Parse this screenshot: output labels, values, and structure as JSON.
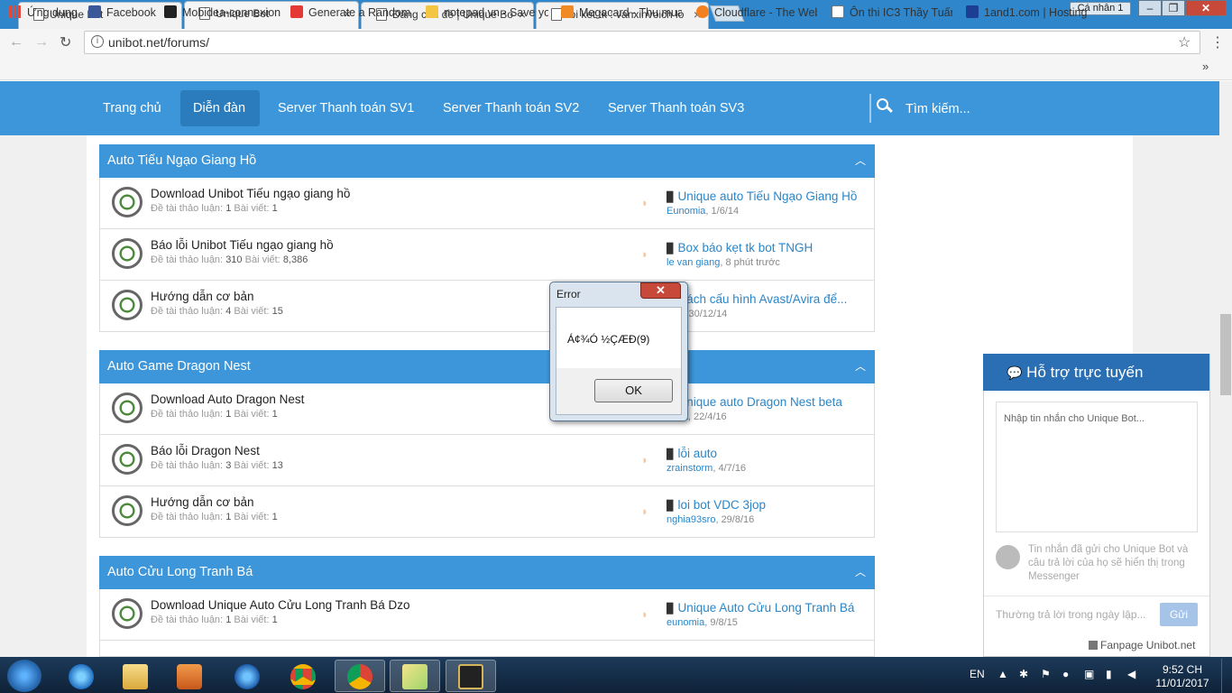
{
  "browser": {
    "tabs": [
      {
        "label": "Unique Bot"
      },
      {
        "label": "Unique Bot"
      },
      {
        "label": "Đăng chủ đề | Unique Bo"
      },
      {
        "label": "loi ket tk : vanxinvoich lo"
      }
    ],
    "profile_label": "Cá nhân 1",
    "url": "unibot.net/forums/",
    "bookmarks": [
      {
        "label": "Ứng dụng",
        "color": "#e04a3a"
      },
      {
        "label": "Facebook",
        "color": "#3b5998"
      },
      {
        "label": "Mobidea-connexion",
        "color": "#222222"
      },
      {
        "label": "Generate a Random N",
        "color": "#e53935"
      },
      {
        "label": "notepad.vn - Save you",
        "color": "#f4c542"
      },
      {
        "label": "Megacard - Thu mua",
        "color": "#f08a24"
      },
      {
        "label": "Cloudflare - The Web",
        "color": "#f38020"
      },
      {
        "label": "Ôn thi IC3 Thầy Tuấn",
        "color": "#ffffff"
      },
      {
        "label": "1and1.com | Hosting,",
        "color": "#1c3f94"
      }
    ]
  },
  "site_nav": {
    "items": [
      {
        "label": "Trang chủ",
        "active": false
      },
      {
        "label": "Diễn đàn",
        "active": true
      },
      {
        "label": "Server Thanh toán SV1",
        "active": false
      },
      {
        "label": "Server Thanh toán SV2",
        "active": false
      },
      {
        "label": "Server Thanh toán SV3",
        "active": false
      }
    ],
    "search_label": "Tìm kiếm..."
  },
  "categories": [
    {
      "title": "Auto Tiếu Ngạo Giang Hồ",
      "forums": [
        {
          "title": "Download Unibot Tiếu ngạo giang hồ",
          "threads_label": "Đề tài thảo luận:",
          "threads": "1",
          "posts_label": "Bài viết:",
          "posts": "1",
          "last_title": "Unique auto Tiếu Ngạo Giang Hồ",
          "last_user": "Eunomia",
          "last_time": "1/6/14"
        },
        {
          "title": "Báo lỗi Unibot Tiếu ngạo giang hồ",
          "threads_label": "Đề tài thảo luận:",
          "threads": "310",
          "posts_label": "Bài viết:",
          "posts": "8,386",
          "last_title": "Box báo kẹt tk bot TNGH",
          "last_user": "le van giang",
          "last_time": "8 phút trước"
        },
        {
          "title": "Hướng dẫn cơ bản",
          "threads_label": "Đề tài thảo luận:",
          "threads": "4",
          "posts_label": "Bài viết:",
          "posts": "15",
          "last_title": "Cách cấu hình Avast/Avira để...",
          "last_user": "eda",
          "last_time": "30/12/14"
        }
      ]
    },
    {
      "title": "Auto Game Dragon Nest",
      "forums": [
        {
          "title": "Download Auto Dragon Nest",
          "threads_label": "Đề tài thảo luận:",
          "threads": "1",
          "posts_label": "Bài viết:",
          "posts": "1",
          "last_title": "Unique auto Dragon Nest beta",
          "last_user": "omia",
          "last_time": "22/4/16"
        },
        {
          "title": "Báo lỗi Dragon Nest",
          "threads_label": "Đề tài thảo luận:",
          "threads": "3",
          "posts_label": "Bài viết:",
          "posts": "13",
          "last_title": "lỗi auto",
          "last_user": "zrainstorm",
          "last_time": "4/7/16"
        },
        {
          "title": "Hướng dẫn cơ bản",
          "threads_label": "Đề tài thảo luận:",
          "threads": "1",
          "posts_label": "Bài viết:",
          "posts": "1",
          "last_title": "loi bot VDC 3jop",
          "last_user": "nghia93sro",
          "last_time": "29/8/16"
        }
      ]
    },
    {
      "title": "Auto Cửu Long Tranh Bá",
      "forums": [
        {
          "title": "Download Unique Auto Cửu Long Tranh Bá Dzo",
          "threads_label": "Đề tài thảo luận:",
          "threads": "1",
          "posts_label": "Bài viết:",
          "posts": "1",
          "last_title": "Unique Auto Cửu Long Tranh Bá",
          "last_user": "eunomia",
          "last_time": "9/8/15"
        }
      ]
    }
  ],
  "chat": {
    "header": "Hỗ trợ trực tuyến",
    "input_placeholder": "Nhập tin nhắn cho Unique Bot...",
    "note": "Tin nhắn đã gửi cho Unique Bot và câu trả lời của họ sẽ hiển thị trong Messenger",
    "reply_placeholder": "Thường trả lời trong ngày lập...",
    "send_label": "Gửi",
    "fanpage_label": "Fanpage Unibot.net"
  },
  "dialog": {
    "title": "Error",
    "message": "Á¢¾Ó ½ÇÆÐ(9)",
    "ok_label": "OK"
  },
  "taskbar": {
    "language": "EN",
    "time": "9:52 CH",
    "date": "11/01/2017"
  }
}
